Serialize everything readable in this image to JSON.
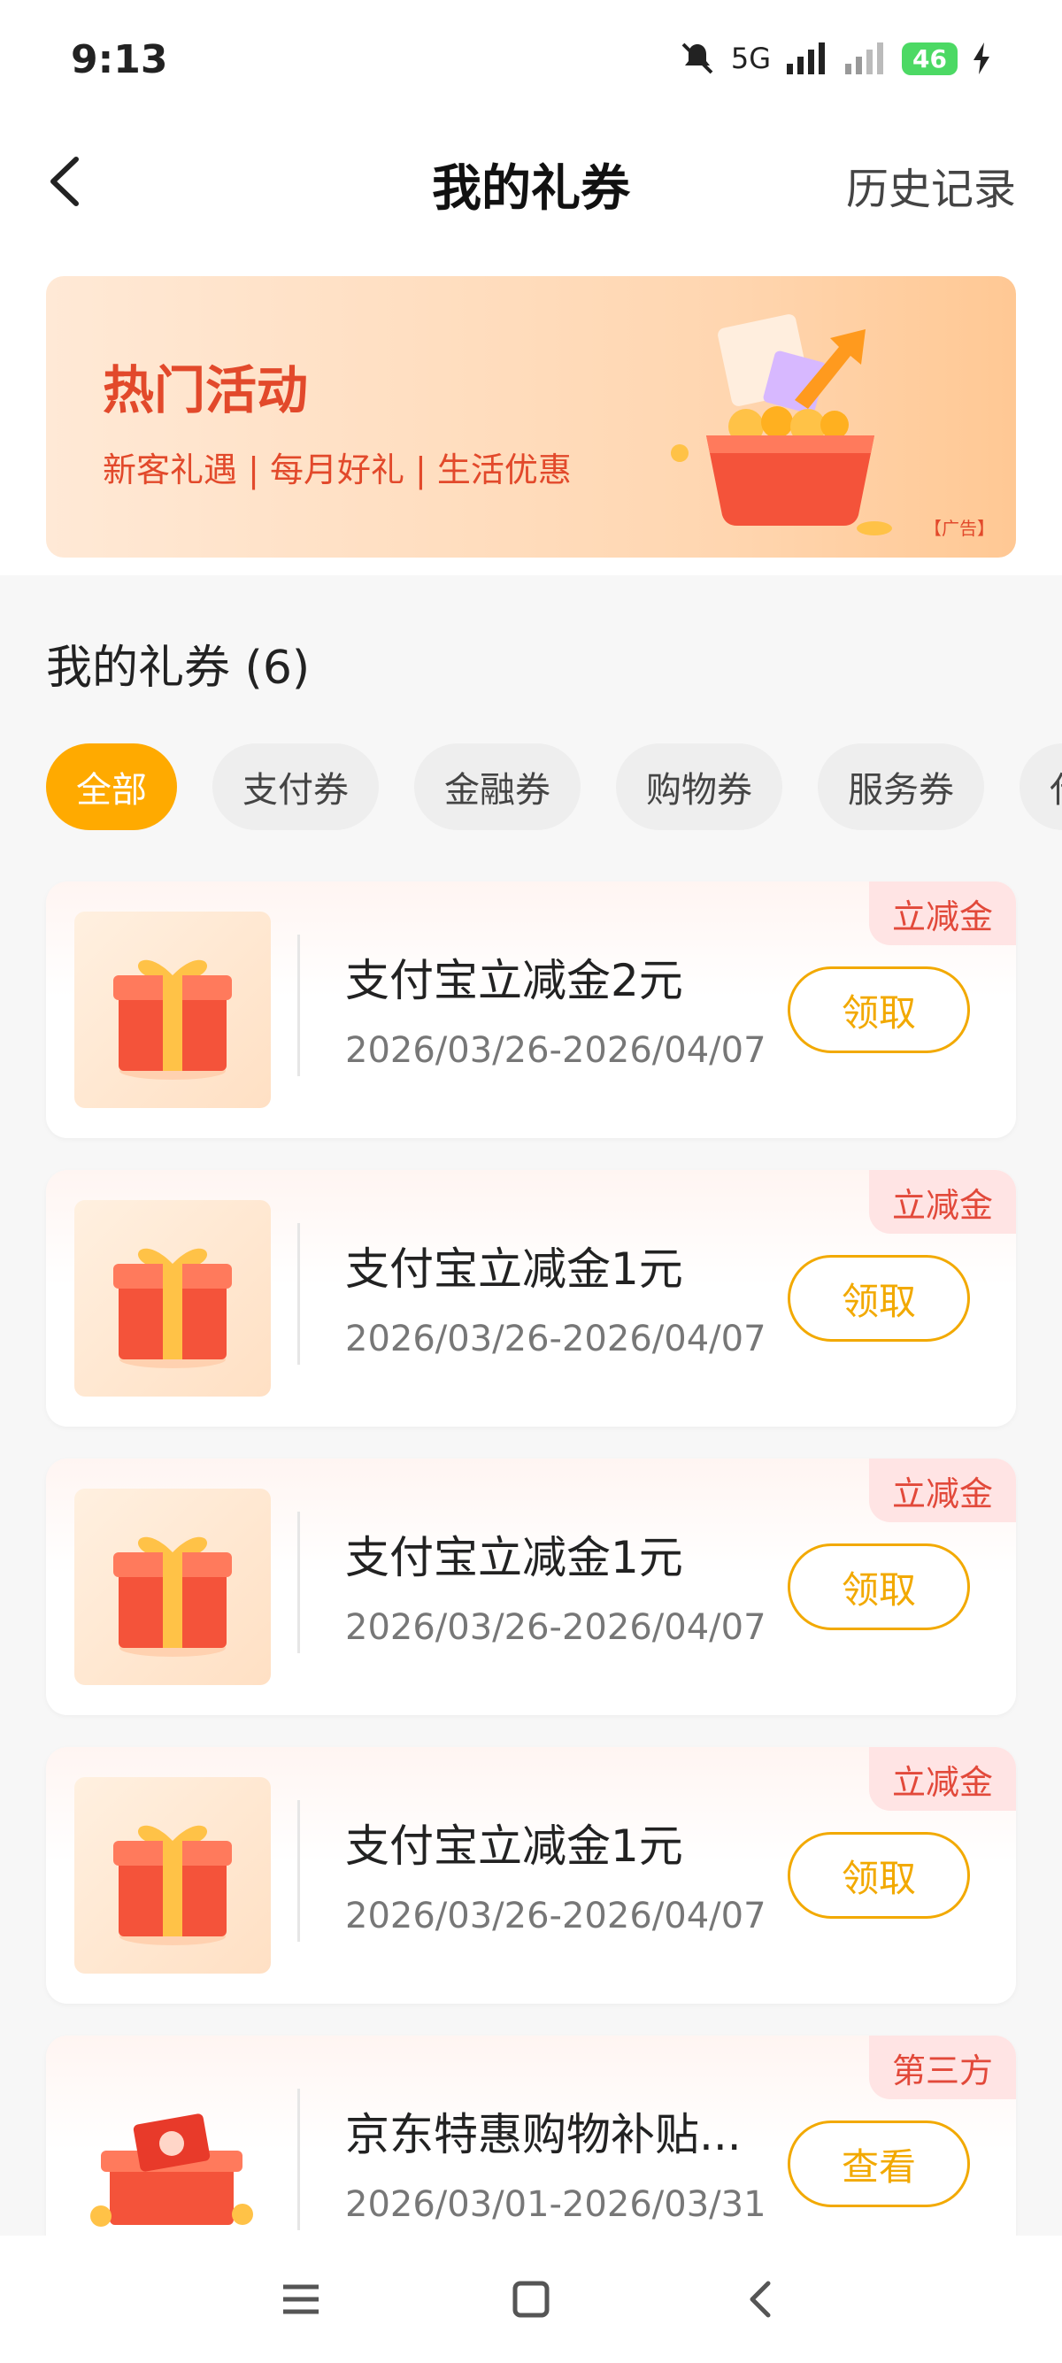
{
  "status_bar": {
    "time": "9:13",
    "network": "5G",
    "battery": "46"
  },
  "nav": {
    "title": "我的礼券",
    "history": "历史记录"
  },
  "banner": {
    "title": "热门活动",
    "subtitle": "新客礼遇 | 每月好礼 | 生活优惠",
    "ad": "【广告】"
  },
  "section": {
    "title": "我的礼券 (6)"
  },
  "tabs": [
    "全部",
    "支付券",
    "金融券",
    "购物券",
    "服务券",
    "代"
  ],
  "coupons": [
    {
      "title": "支付宝立减金2元",
      "date": "2026/03/26-2026/04/07",
      "tag": "立减金",
      "button": "领取",
      "thumb": "gift-box-icon"
    },
    {
      "title": "支付宝立减金1元",
      "date": "2026/03/26-2026/04/07",
      "tag": "立减金",
      "button": "领取",
      "thumb": "gift-box-icon"
    },
    {
      "title": "支付宝立减金1元",
      "date": "2026/03/26-2026/04/07",
      "tag": "立减金",
      "button": "领取",
      "thumb": "gift-box-icon"
    },
    {
      "title": "支付宝立减金1元",
      "date": "2026/03/26-2026/04/07",
      "tag": "立减金",
      "button": "领取",
      "thumb": "gift-box-icon"
    },
    {
      "title": "京东特惠购物补贴...",
      "date": "2026/03/01-2026/03/31",
      "tag": "第三方",
      "button": "查看",
      "thumb": "gift-pile-icon"
    }
  ],
  "colors": {
    "accent": "#ffaa00",
    "tag_text": "#e2493a",
    "banner_text": "#e2492b"
  }
}
